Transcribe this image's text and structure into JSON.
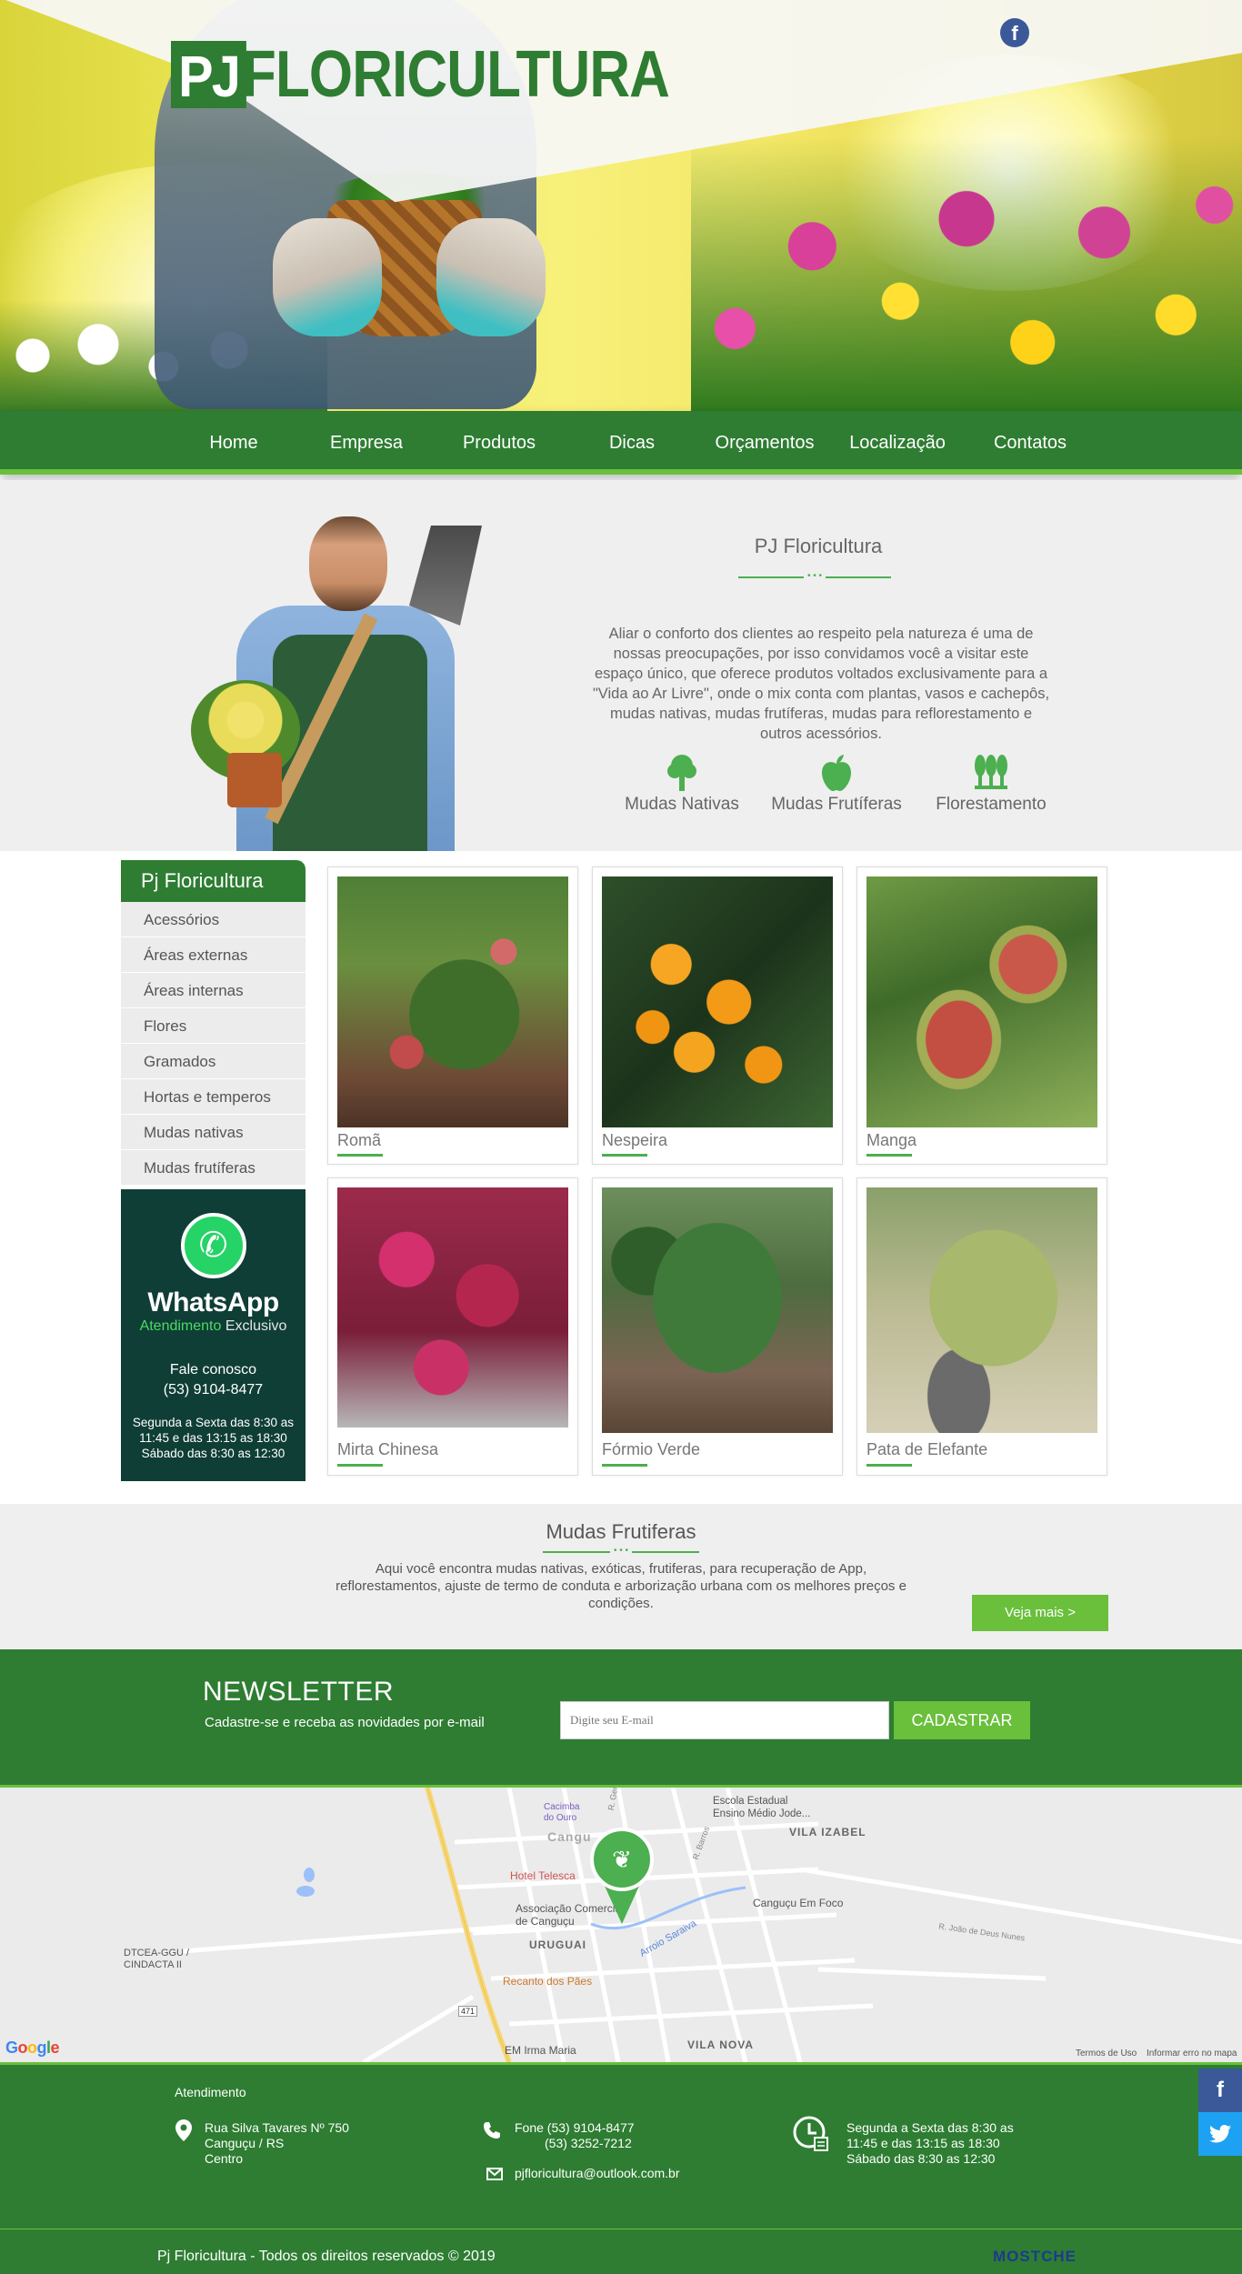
{
  "brand": {
    "logo_pj": "PJ",
    "logo_name": "FLORICULTURA"
  },
  "header": {
    "facebook_icon": "f"
  },
  "nav": {
    "items": [
      "Home",
      "Empresa",
      "Produtos",
      "Dicas",
      "Orçamentos",
      "Localização",
      "Contatos"
    ]
  },
  "about": {
    "title": "PJ Floricultura",
    "text": "Aliar o conforto dos clientes ao respeito pela natureza é uma de nossas preocupações, por isso convidamos você a visitar este espaço único, que oferece produtos voltados exclusivamente para a \"Vida ao Ar Livre\", onde o mix conta com plantas, vasos e cachepôs, mudas nativas, mudas frutíferas, mudas para reflorestamento e outros acessórios.",
    "features": [
      {
        "label": "Mudas Nativas",
        "icon": "tree-icon"
      },
      {
        "label": "Mudas Frutíferas",
        "icon": "apple-icon"
      },
      {
        "label": "Florestamento",
        "icon": "forest-icon"
      }
    ]
  },
  "sidebar": {
    "title": "Pj Floricultura",
    "items": [
      "Acessórios",
      "Áreas externas",
      "Áreas internas",
      "Flores",
      "Gramados",
      "Hortas e temperos",
      "Mudas nativas",
      "Mudas frutíferas"
    ]
  },
  "whatsapp": {
    "brand": "WhatsApp",
    "sub_highlight": "Atendimento",
    "sub_rest": " Exclusivo",
    "fale": "Fale conosco",
    "phone": "(53) 9104-8477",
    "hours": "Segunda a Sexta das 8:30 as 11:45 e das 13:15 as 18:30 Sábado das 8:30 as 12:30"
  },
  "products": [
    {
      "name": "Romã"
    },
    {
      "name": "Nespeira"
    },
    {
      "name": "Manga"
    },
    {
      "name": "Mirta Chinesa"
    },
    {
      "name": "Fórmio Verde"
    },
    {
      "name": "Pata de Elefante"
    }
  ],
  "mudas": {
    "title": "Mudas Frutiferas",
    "text": "Aqui você encontra mudas nativas, exóticas, frutiferas, para recuperação de App, reflorestamentos, ajuste de termo de conduta e arborização urbana com os melhores preços e condições.",
    "button": "Veja mais >"
  },
  "newsletter": {
    "title": "NEWSLETTER",
    "subtitle": "Cadastre-se e receba as novidades por e-mail",
    "placeholder": "Digite seu E-mail",
    "button": "CADASTRAR"
  },
  "map": {
    "labels": {
      "escola": "Escola Estadual\nEnsino Médio Jode...",
      "vila_izabel": "VILA IZABEL",
      "cacimba": "Cacimba\ndo Ouro",
      "cangucu": "Cangu",
      "hotel": "Hotel Telesca",
      "associacao": "Associação Comercial\nde Canguçu",
      "em_foco": "Canguçu Em Foco",
      "uruguai": "URUGUAI",
      "dtcea": "DTCEA-GGU /\nCINDACTA II",
      "recanto": "Recanto dos Pães",
      "vila_nova": "VILA NOVA",
      "em_irma": "EM Irma Maria",
      "arroio": "Arroio Saraiva",
      "r_joao": "R. João de Deus Nunes",
      "r_gen": "R. Gen",
      "r_barros": "R. Barros",
      "road_471": "471"
    },
    "google": [
      "G",
      "o",
      "o",
      "g",
      "l",
      "e"
    ],
    "terms": "Termos de Uso",
    "report": "Informar erro no mapa"
  },
  "footer": {
    "attendance": "Atendimento",
    "address": [
      "Rua Silva Tavares Nº 750",
      "Canguçu / RS",
      "Centro"
    ],
    "phones": [
      "Fone (53) 9104-8477",
      "(53) 3252-7212"
    ],
    "email": "pjfloricultura@outlook.com.br",
    "hours": "Segunda a Sexta das 8:30 as 11:45 e das 13:15 as 18:30 Sábado das 8:30 as 12:30",
    "copyright": "Pj Floricultura - Todos os direitos reservados © 2019",
    "dev_brand": "MOSTCHE"
  },
  "social": {
    "facebook": "f",
    "twitter": "t"
  },
  "colors": {
    "primary_green": "#2e7d32",
    "accent_green": "#6abf3b",
    "whatsapp_bg": "#0f3e36"
  }
}
